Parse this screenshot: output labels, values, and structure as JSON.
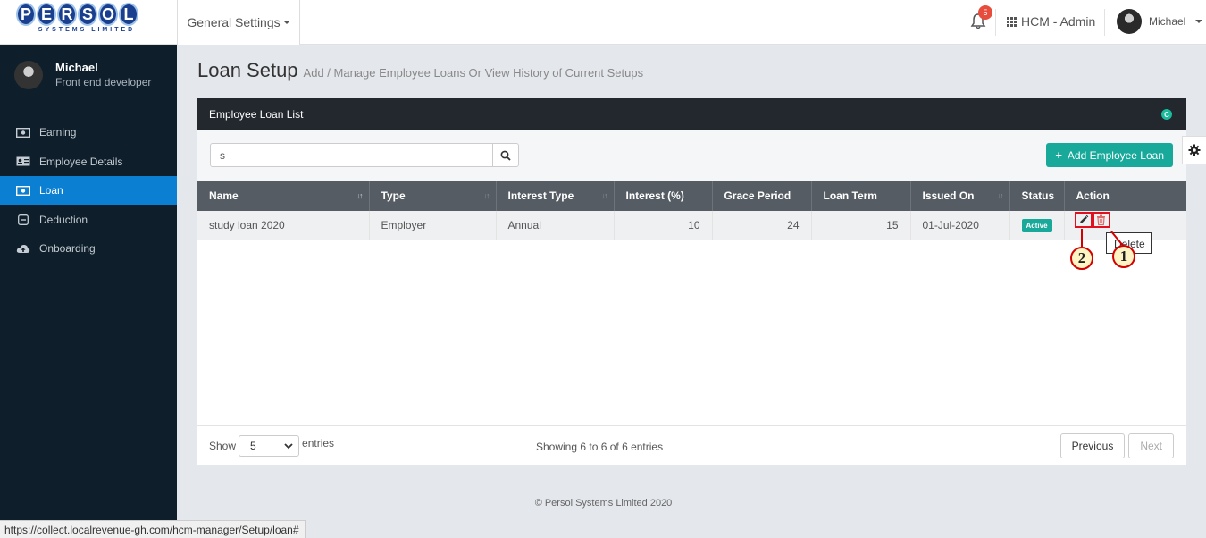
{
  "header": {
    "logo_text": "PERSOL",
    "logo_letters": [
      "P",
      "E",
      "R",
      "S",
      "O",
      "L"
    ],
    "logo_sub": "SYSTEMS LIMITED",
    "general_settings": "General Settings",
    "notification_count": "5",
    "app_name": "HCM - Admin",
    "user_name": "Michael"
  },
  "sidebar": {
    "profile_name": "Michael",
    "profile_role": "Front end developer",
    "items": [
      {
        "label": "Earning",
        "icon": "money-icon",
        "active": false
      },
      {
        "label": "Employee Details",
        "icon": "id-card-icon",
        "active": false
      },
      {
        "label": "Loan",
        "icon": "money-icon",
        "active": true
      },
      {
        "label": "Deduction",
        "icon": "minus-square-icon",
        "active": false
      },
      {
        "label": "Onboarding",
        "icon": "cloud-upload-icon",
        "active": false
      }
    ]
  },
  "page": {
    "title": "Loan Setup",
    "subtitle": "Add / Manage Employee Loans Or View History of Current Setups"
  },
  "panel": {
    "title": "Employee Loan List",
    "search_value": "s",
    "add_button": "Add Employee Loan"
  },
  "table": {
    "columns": [
      "Name",
      "Type",
      "Interest Type",
      "Interest (%)",
      "Grace Period",
      "Loan Term",
      "Issued On",
      "Status",
      "Action"
    ],
    "rows": [
      {
        "name": "study loan 2020",
        "type": "Employer",
        "interest_type": "Annual",
        "interest": "10",
        "grace_period": "24",
        "loan_term": "15",
        "issued_on": "01-Jul-2020",
        "status": "Active"
      }
    ]
  },
  "footer_bar": {
    "show_label": "Show",
    "show_value": "5",
    "entries_label": "entries",
    "showing_text": "Showing 6 to 6 of 6 entries",
    "previous": "Previous",
    "next": "Next"
  },
  "tooltip": "Delete",
  "callouts": [
    "1",
    "2"
  ],
  "copyright": "© Persol Systems Limited 2020",
  "status_url": "https://collect.localrevenue-gh.com/hcm-manager/Setup/loan#",
  "colors": {
    "sidebar_bg": "#0f1e2b",
    "active_nav": "#0b7fd1",
    "accent_teal": "#18a99a",
    "table_header": "#555c63",
    "callout_red": "#d40000"
  }
}
